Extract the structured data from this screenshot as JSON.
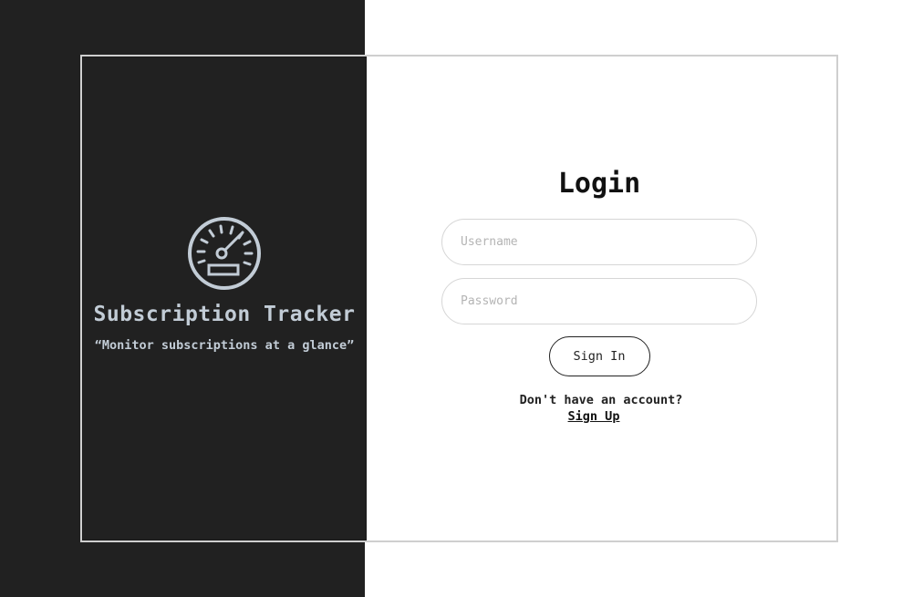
{
  "brand": {
    "icon": "speedometer-icon",
    "title": "Subscription Tracker",
    "tagline": "“Monitor subscriptions at a glance”",
    "icon_color": "#c2ccd6"
  },
  "login": {
    "heading": "Login",
    "username_placeholder": "Username",
    "password_placeholder": "Password",
    "signin_label": "Sign In",
    "signup_prompt": "Don't have an account?",
    "signup_link": "Sign Up"
  },
  "colors": {
    "dark_panel": "#212121",
    "card_border": "#cfcfcf",
    "text_dark": "#111111"
  }
}
